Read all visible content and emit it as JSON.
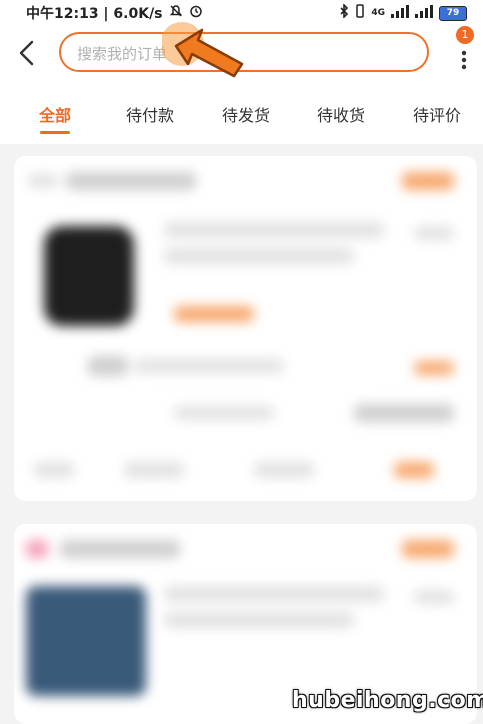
{
  "status_bar": {
    "left_text": "中午12:13 | 6.0K/s",
    "right_signal": "4G",
    "battery": "79"
  },
  "header": {
    "search_placeholder": "搜索我的订单",
    "more_badge": "1"
  },
  "tabs": [
    {
      "label": "全部",
      "active": true
    },
    {
      "label": "待付款",
      "active": false
    },
    {
      "label": "待发货",
      "active": false
    },
    {
      "label": "待收货",
      "active": false
    },
    {
      "label": "待评价",
      "active": false
    }
  ],
  "watermark": "hubeihong.com",
  "colors": {
    "accent": "#f06a24",
    "search_border": "#f0712a"
  }
}
